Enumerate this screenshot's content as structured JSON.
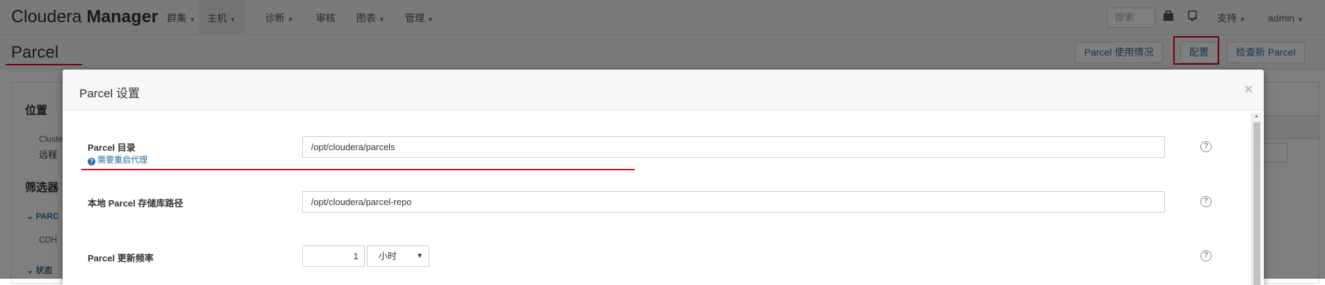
{
  "navbar": {
    "brand_light": "Cloudera ",
    "brand_bold": "Manager",
    "items": [
      {
        "label": "群集"
      },
      {
        "label": "主机"
      },
      {
        "label": "诊断"
      },
      {
        "label": "审核"
      },
      {
        "label": "图表"
      },
      {
        "label": "管理"
      }
    ],
    "active_item": "主机",
    "search_placeholder": "搜索",
    "support_label": "支持",
    "user_label": "admin"
  },
  "page": {
    "title": "Parcel",
    "buttons": {
      "usage": "Parcel 使用情况",
      "config": "配置",
      "check_new": "检查新 Parcel"
    }
  },
  "background": {
    "section_location": "位置",
    "line1": "Cluste",
    "line2": "远程",
    "section_filters": "筛选器",
    "filter_parcel": "PARC",
    "filter_cdh": "CDH",
    "filter_status": "状态"
  },
  "modal": {
    "title": "Parcel 设置",
    "close_symbol": "×",
    "rows": [
      {
        "label": "Parcel 目录",
        "note": "需要重启代理",
        "value": "/opt/cloudera/parcels"
      },
      {
        "label": "本地 Parcel 存储库路径",
        "value": "/opt/cloudera/parcel-repo"
      },
      {
        "label": "Parcel 更新频率",
        "value": "1",
        "unit": "小时"
      }
    ]
  },
  "colors": {
    "highlight": "#e0001a",
    "link": "#2a6a9e"
  }
}
